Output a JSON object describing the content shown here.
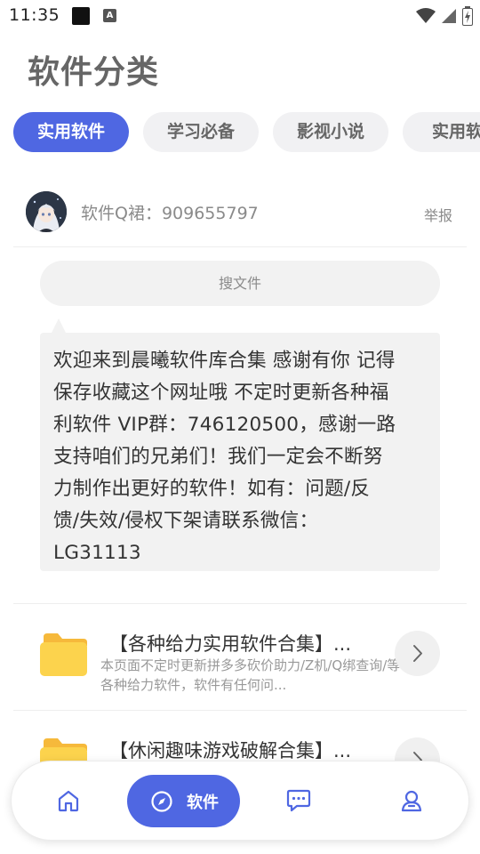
{
  "status_bar": {
    "time": "11:35",
    "notif_a": "A"
  },
  "page_title": "软件分类",
  "tabs": [
    {
      "label": "实用软件",
      "active": true
    },
    {
      "label": "学习必备",
      "active": false
    },
    {
      "label": "影视小说",
      "active": false
    },
    {
      "label": "实用软",
      "active": false
    }
  ],
  "author": {
    "name": "软件Q裙：909655797",
    "report": "举报"
  },
  "search": {
    "placeholder": "搜文件"
  },
  "notice": {
    "lines": [
      "欢迎来到晨曦软件库合集 感谢有你 记得",
      "保存收藏这个网址哦 不定时更新各种福",
      "利软件 VIP群：746120500，感谢一路",
      "支持咱们的兄弟们！我们一定会不断努",
      "力制作出更好的软件！如有：问题/反",
      "馈/失效/侵权下架请联系微信：",
      "LG31113"
    ]
  },
  "items": [
    {
      "title": "【各种给力实用软件合集】...",
      "desc": "本页面不定时更新拼多多砍价助力/Z机/Q绑查询/等各种给力软件，软件有任何问..."
    },
    {
      "title": "【休闲趣味游戏破解合集】...",
      "desc": ""
    }
  ],
  "nav": {
    "software_label": "软件"
  },
  "colors": {
    "accent": "#4f67e2",
    "folder": "#fcd34d",
    "folder_tab": "#f6b93b"
  }
}
